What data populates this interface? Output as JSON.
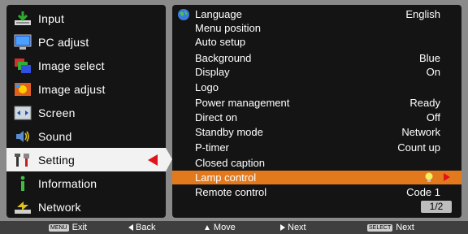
{
  "left_menu": {
    "items": [
      {
        "label": "Input",
        "icon": "input-icon"
      },
      {
        "label": "PC adjust",
        "icon": "pc-adjust-icon"
      },
      {
        "label": "Image select",
        "icon": "image-select-icon"
      },
      {
        "label": "Image adjust",
        "icon": "image-adjust-icon"
      },
      {
        "label": "Screen",
        "icon": "screen-icon"
      },
      {
        "label": "Sound",
        "icon": "sound-icon"
      },
      {
        "label": "Setting",
        "icon": "setting-icon",
        "selected": true
      },
      {
        "label": "Information",
        "icon": "information-icon"
      },
      {
        "label": "Network",
        "icon": "network-icon"
      }
    ]
  },
  "submenu": {
    "items": [
      {
        "label": "Language",
        "value": "English"
      },
      {
        "label": "Menu position",
        "value": ""
      },
      {
        "label": "Auto setup",
        "value": ""
      },
      {
        "label": "Background",
        "value": "Blue"
      },
      {
        "label": "Display",
        "value": "On"
      },
      {
        "label": "Logo",
        "value": ""
      },
      {
        "label": "Power management",
        "value": "Ready"
      },
      {
        "label": "Direct on",
        "value": "Off"
      },
      {
        "label": "Standby mode",
        "value": "Network"
      },
      {
        "label": "P-timer",
        "value": "Count up"
      },
      {
        "label": "Closed caption",
        "value": ""
      },
      {
        "label": "Lamp control",
        "value": "",
        "selected": true
      },
      {
        "label": "Remote control",
        "value": "Code 1"
      }
    ],
    "page": "1/2"
  },
  "bottom_bar": {
    "exit_key": "MENU",
    "exit": "Exit",
    "back": "Back",
    "move": "Move",
    "next1": "Next",
    "select_key": "SELECT",
    "next2": "Next"
  },
  "colors": {
    "panel": "#141414",
    "highlight": "#e3791d",
    "selected_left": "#f2f2f2",
    "arrow": "#e0131a"
  }
}
